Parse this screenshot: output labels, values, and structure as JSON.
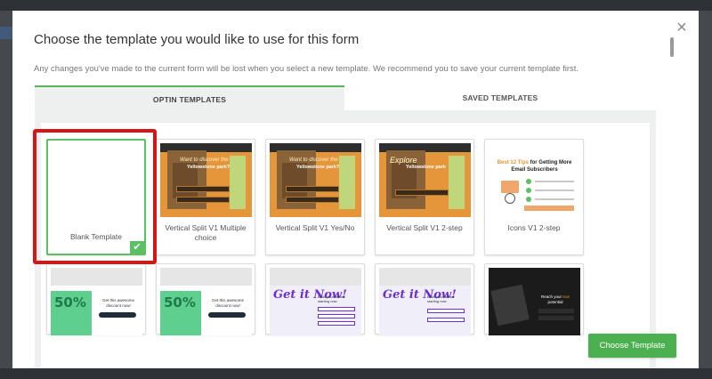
{
  "modal": {
    "title": "Choose the template you would like to use for this form",
    "subtitle": "Any changes you've made to the current form will be lost when you select a new template. We recommend you to save your current template first.",
    "close_icon": "close-icon"
  },
  "tabs": [
    {
      "label": "OPTIN TEMPLATES",
      "active": true
    },
    {
      "label": "SAVED TEMPLATES",
      "active": false
    }
  ],
  "templates_row1": [
    {
      "caption": "Blank Template",
      "selected": true
    },
    {
      "caption": "Vertical Split V1 Multiple choice",
      "thumb_tagline": "Want to discover the",
      "thumb_headline": "Yellowstone park?"
    },
    {
      "caption": "Vertical Split V1 Yes/No",
      "thumb_tagline": "Want to discover the",
      "thumb_headline": "Yellowstone park?"
    },
    {
      "caption": "Vertical Split V1 2-step",
      "thumb_tagline": "Explore",
      "thumb_headline": "Yellowstone park"
    },
    {
      "caption": "Icons V1 2-step",
      "thumb_title_prefix": "Best 12 Tips",
      "thumb_title_rest": " for Getting More Email Subscribers"
    }
  ],
  "templates_row2": [
    {
      "thumb_big": "50%",
      "thumb_text": "Get this awesome discount now!"
    },
    {
      "thumb_big": "50%",
      "thumb_text": "Get this awesome discount now!"
    },
    {
      "thumb_script": "Get it Now!",
      "thumb_text": "Build your dream starting now"
    },
    {
      "thumb_script": "Get it Now!",
      "thumb_text": "Build your dream starting now"
    },
    {
      "thumb_text_prefix": "Reach your ",
      "thumb_text_highlight": "true",
      "thumb_text_rest": " potential"
    }
  ],
  "footer": {
    "choose_label": "Choose Template"
  },
  "colors": {
    "accent_green": "#4caf50",
    "selection_red": "#d91414",
    "thumb_orange": "#e5953a"
  }
}
